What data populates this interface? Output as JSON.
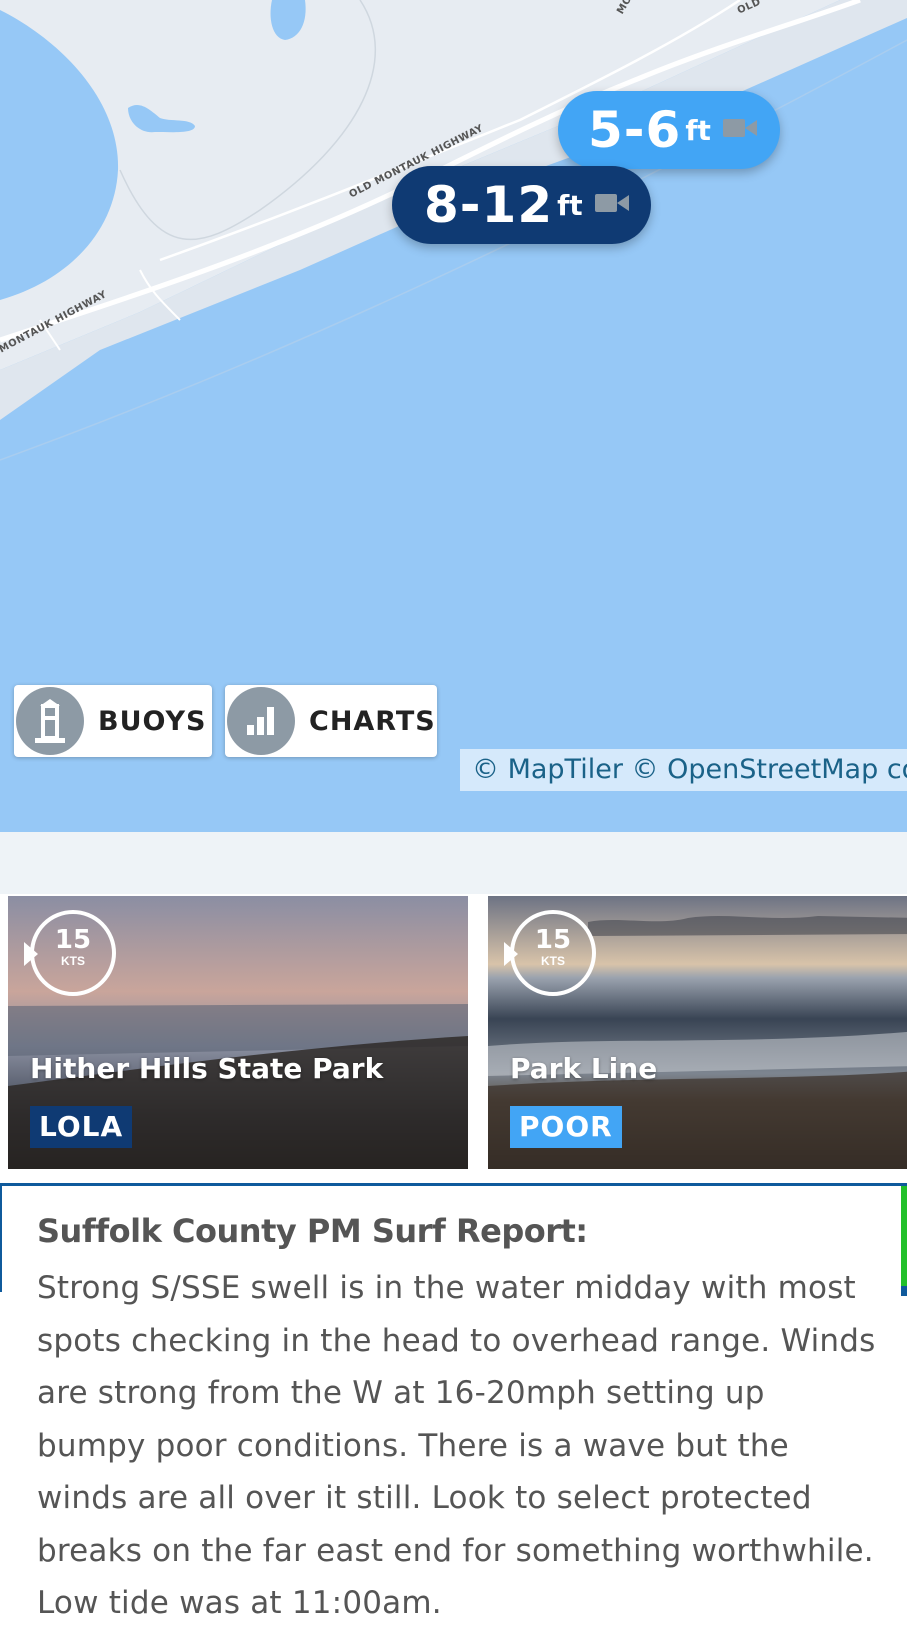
{
  "map": {
    "road_labels": [
      "OLD MONTAUK HIGHWAY",
      "MONTAUK HIGHWAY",
      "MO",
      "OLD"
    ],
    "markers": [
      {
        "height": "5-6",
        "unit": "ft",
        "icon": "camera-icon",
        "color": "#42a5f5"
      },
      {
        "height": "8-12",
        "unit": "ft",
        "icon": "camera-icon",
        "color": "#0f3a73"
      }
    ],
    "buttons": {
      "buoys": {
        "label": "BUOYS",
        "icon": "lighthouse-icon"
      },
      "charts": {
        "label": "CHARTS",
        "icon": "bar-chart-icon"
      }
    },
    "attribution": "© MapTiler © OpenStreetMap co"
  },
  "cams": [
    {
      "wind": "15",
      "wind_unit": "KTS",
      "name": "Hither Hills State Park",
      "rating": "LOLA",
      "rating_color": "#0f3a73"
    },
    {
      "wind": "15",
      "wind_unit": "KTS",
      "name": "Park Line",
      "rating": "POOR",
      "rating_color": "#42a5f5"
    }
  ],
  "report": {
    "title": "Suffolk County PM Surf Report:",
    "body": "Strong S/SSE swell is in the water midday with most spots checking in the head to overhead range. Winds are strong from the W at 16-20mph setting up bumpy poor conditions. There is a wave but the winds are all over it still. Look to select protected breaks on the far east end for something worthwhile. Low tide was at 11:00am."
  }
}
